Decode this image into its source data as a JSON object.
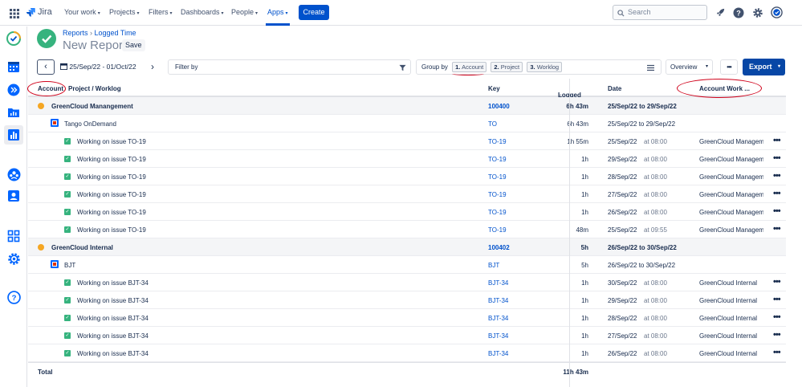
{
  "topnav": {
    "logo": "Jira",
    "items": [
      "Your work",
      "Projects",
      "Filters",
      "Dashboards",
      "People",
      "Apps"
    ],
    "create_label": "Create",
    "search_placeholder": "Search"
  },
  "header": {
    "breadcrumb_root": "Reports",
    "breadcrumb_current": "Logged Time",
    "title": "New Report",
    "save_label": "Save"
  },
  "toolbar": {
    "date_range": "25/Sep/22 - 01/Oct/22",
    "filter_label": "Filter by",
    "group_by_label": "Group by",
    "group_chips": [
      {
        "num": "1.",
        "label": "Account"
      },
      {
        "num": "2.",
        "label": "Project"
      },
      {
        "num": "3.",
        "label": "Worklog"
      }
    ],
    "view_label": "Overview",
    "more_label": "•••",
    "export_label": "Export"
  },
  "table": {
    "columns": {
      "account": "Account",
      "project": "Project / Worklog",
      "key": "Key",
      "logged": "Logged",
      "date": "Date",
      "account_work": "Account Work ..."
    },
    "rows": [
      {
        "type": "account",
        "name": "GreenCloud Manangement",
        "key": "100400",
        "logged": "6h 43m",
        "date": "25/Sep/22 to 29/Sep/22"
      },
      {
        "type": "project",
        "name": "Tango OnDemand",
        "key": "TO",
        "logged": "6h 43m",
        "date": "25/Sep/22 to 29/Sep/22"
      },
      {
        "type": "worklog",
        "name": "Working on issue TO-19",
        "key": "TO-19",
        "logged": "1h 55m",
        "date": "25/Sep/22",
        "time": "at 08:00",
        "account": "GreenCloud Managem"
      },
      {
        "type": "worklog",
        "name": "Working on issue TO-19",
        "key": "TO-19",
        "logged": "1h",
        "date": "29/Sep/22",
        "time": "at 08:00",
        "account": "GreenCloud Managem"
      },
      {
        "type": "worklog",
        "name": "Working on issue TO-19",
        "key": "TO-19",
        "logged": "1h",
        "date": "28/Sep/22",
        "time": "at 08:00",
        "account": "GreenCloud Managem"
      },
      {
        "type": "worklog",
        "name": "Working on issue TO-19",
        "key": "TO-19",
        "logged": "1h",
        "date": "27/Sep/22",
        "time": "at 08:00",
        "account": "GreenCloud Managem"
      },
      {
        "type": "worklog",
        "name": "Working on issue TO-19",
        "key": "TO-19",
        "logged": "1h",
        "date": "26/Sep/22",
        "time": "at 08:00",
        "account": "GreenCloud Managem"
      },
      {
        "type": "worklog",
        "name": "Working on issue TO-19",
        "key": "TO-19",
        "logged": "48m",
        "date": "25/Sep/22",
        "time": "at 09:55",
        "account": "GreenCloud Managem"
      },
      {
        "type": "account",
        "name": "GreenCloud Internal",
        "key": "100402",
        "logged": "5h",
        "date": "26/Sep/22 to 30/Sep/22"
      },
      {
        "type": "project",
        "name": "BJT",
        "key": "BJT",
        "logged": "5h",
        "date": "26/Sep/22 to 30/Sep/22"
      },
      {
        "type": "worklog",
        "name": "Working on issue BJT-34",
        "key": "BJT-34",
        "logged": "1h",
        "date": "30/Sep/22",
        "time": "at 08:00",
        "account": "GreenCloud Internal"
      },
      {
        "type": "worklog",
        "name": "Working on issue BJT-34",
        "key": "BJT-34",
        "logged": "1h",
        "date": "29/Sep/22",
        "time": "at 08:00",
        "account": "GreenCloud Internal"
      },
      {
        "type": "worklog",
        "name": "Working on issue BJT-34",
        "key": "BJT-34",
        "logged": "1h",
        "date": "28/Sep/22",
        "time": "at 08:00",
        "account": "GreenCloud Internal"
      },
      {
        "type": "worklog",
        "name": "Working on issue BJT-34",
        "key": "BJT-34",
        "logged": "1h",
        "date": "27/Sep/22",
        "time": "at 08:00",
        "account": "GreenCloud Internal"
      },
      {
        "type": "worklog",
        "name": "Working on issue BJT-34",
        "key": "BJT-34",
        "logged": "1h",
        "date": "26/Sep/22",
        "time": "at 08:00",
        "account": "GreenCloud Internal"
      }
    ],
    "total_label": "Total",
    "total_logged": "11h 43m"
  },
  "colors": {
    "brand": "#0052cc",
    "export": "#0747a6",
    "account_dot": "#f5a623",
    "worklog_check": "#36b37e",
    "annotation": "#d0021b"
  }
}
